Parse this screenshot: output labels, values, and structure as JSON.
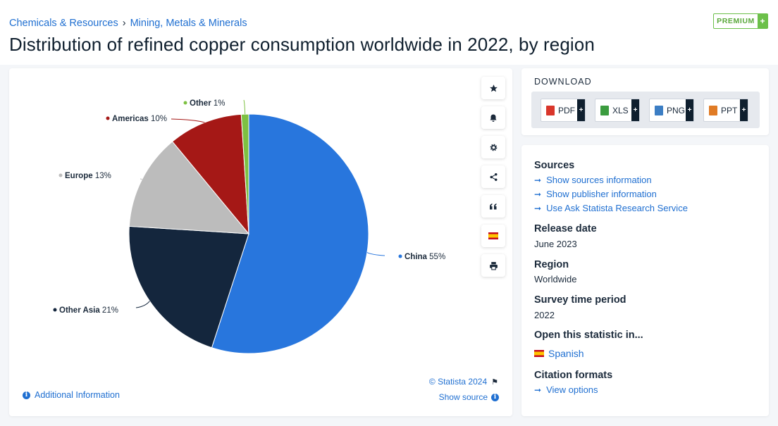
{
  "breadcrumb": {
    "category": "Chemicals & Resources",
    "separator": "›",
    "subcategory": "Mining, Metals & Minerals"
  },
  "page_title": "Distribution of refined copper consumption worldwide in 2022, by region",
  "premium_badge": {
    "label": "PREMIUM",
    "plus": "+"
  },
  "toolbar": {
    "icons": [
      "star-icon",
      "bell-icon",
      "gear-icon",
      "share-icon",
      "quote-icon",
      "spanish-flag-icon",
      "print-icon"
    ]
  },
  "chart_footer": {
    "additional_info": "Additional Information",
    "copyright": "© Statista 2024",
    "show_source": "Show source"
  },
  "chart_data": {
    "type": "pie",
    "title": "",
    "unit": "%",
    "categories": [
      "China",
      "Other Asia",
      "Europe",
      "Americas",
      "Other"
    ],
    "values": [
      55,
      21,
      13,
      10,
      1
    ],
    "colors": [
      "#2876dd",
      "#14263d",
      "#bcbcbc",
      "#a51816",
      "#7dc142"
    ],
    "start_angle_deg": 0,
    "direction": "clockwise",
    "legend": "none"
  },
  "download": {
    "title": "DOWNLOAD",
    "buttons": [
      {
        "label": "PDF",
        "color": "#d9362b"
      },
      {
        "label": "XLS",
        "color": "#3b9c3f"
      },
      {
        "label": "PNG",
        "color": "#3c7ec4"
      },
      {
        "label": "PPT",
        "color": "#e07b25"
      }
    ],
    "plus": "+"
  },
  "sources": {
    "heading": "Sources",
    "links": [
      "Show sources information",
      "Show publisher information",
      "Use Ask Statista Research Service"
    ],
    "arrow": "➞"
  },
  "release_date": {
    "heading": "Release date",
    "value": "June 2023"
  },
  "region": {
    "heading": "Region",
    "value": "Worldwide"
  },
  "survey_period": {
    "heading": "Survey time period",
    "value": "2022"
  },
  "open_in": {
    "heading": "Open this statistic in...",
    "language": "Spanish"
  },
  "citation": {
    "heading": "Citation formats",
    "link": "View options"
  }
}
